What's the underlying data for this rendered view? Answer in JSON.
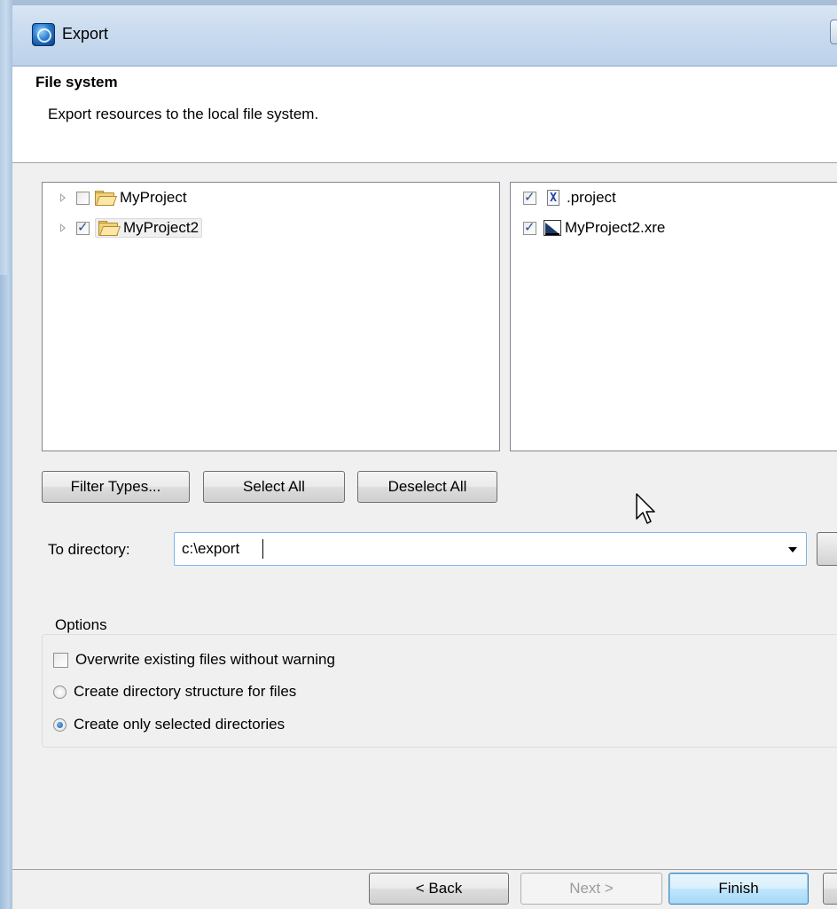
{
  "window": {
    "title": "Export"
  },
  "header": {
    "title": "File system",
    "description": "Export resources to the local file system."
  },
  "left_tree": {
    "items": [
      {
        "label": "MyProject",
        "checked": false,
        "icon": "open-folder-icon"
      },
      {
        "label": "MyProject2",
        "checked": true,
        "icon": "open-folder-icon",
        "selected": true
      }
    ]
  },
  "right_list": {
    "items": [
      {
        "label": ".project",
        "checked": true,
        "icon": "xml-file-icon",
        "icon_glyph": "X"
      },
      {
        "label": "MyProject2.xre",
        "checked": true,
        "icon": "xre-file-icon"
      }
    ]
  },
  "selection_buttons": {
    "filter": "Filter Types...",
    "select_all": "Select All",
    "deselect_all": "Deselect All"
  },
  "directory": {
    "label": "To directory:",
    "value": "c:\\export"
  },
  "options": {
    "legend": "Options",
    "overwrite": {
      "label": "Overwrite existing files without warning",
      "checked": false
    },
    "create_structure": {
      "label": "Create directory structure for files",
      "selected": false
    },
    "create_selected": {
      "label": "Create only selected directories",
      "selected": true
    }
  },
  "footer": {
    "back": "< Back",
    "next": "Next >",
    "finish": "Finish"
  }
}
